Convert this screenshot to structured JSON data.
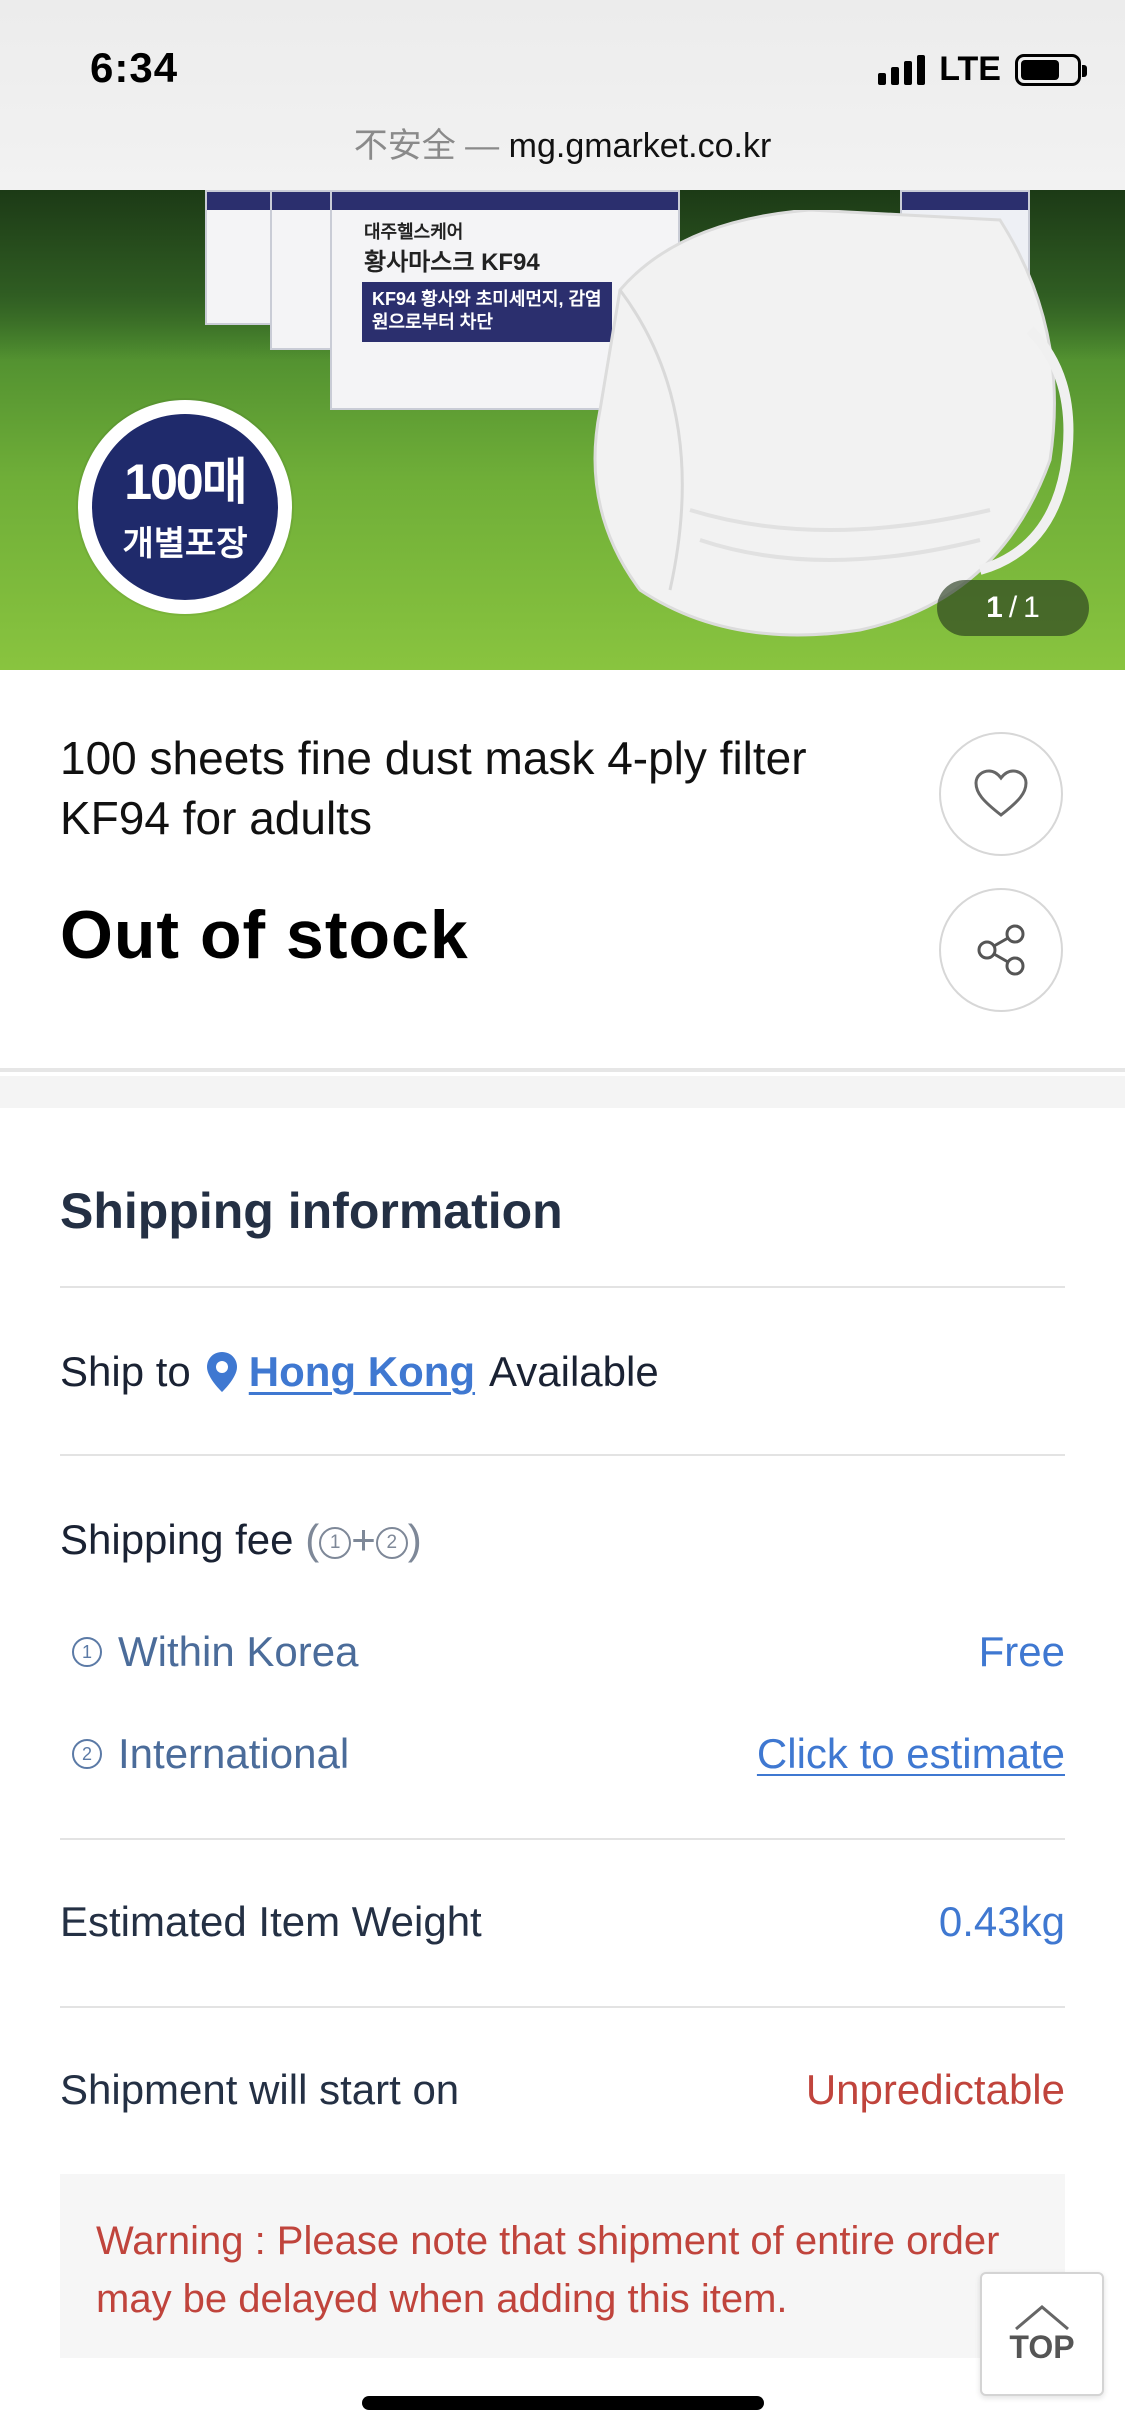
{
  "status_bar": {
    "time": "6:34",
    "network": "LTE"
  },
  "browser": {
    "insecure_label": "不安全",
    "separator": " — ",
    "host": "mg.gmarket.co.kr"
  },
  "product_image": {
    "badge_top": "100매",
    "badge_bottom": "개별포장",
    "box_brand": "대주헬스케어",
    "box_title": "황사마스크 KF94",
    "box_label": "KF94 황사와 초미세먼지, 감염원으로부터 차단",
    "counter_current": "1",
    "counter_separator": "/",
    "counter_total": "1"
  },
  "product": {
    "title": "100 sheets fine dust mask 4-ply filter KF94 for adults",
    "stock_status": "Out of stock"
  },
  "shipping": {
    "section_title": "Shipping information",
    "ship_to_label": "Ship to",
    "country": "Hong Kong",
    "available_label": "Available",
    "fee_label": "Shipping fee",
    "fee_note_open": "(",
    "fee_note_plus": "+",
    "fee_note_close": ")",
    "circle_1": "1",
    "circle_2": "2",
    "within_label": "Within Korea",
    "within_value": "Free",
    "international_label": "International",
    "international_link": "Click to estimate",
    "weight_label": "Estimated Item Weight",
    "weight_value": "0.43kg",
    "start_label": "Shipment will start on",
    "start_value": "Unpredictable",
    "warning": "Warning : Please note that shipment of entire order may be delayed when adding this item."
  },
  "top_button": {
    "label": "TOP"
  },
  "colors": {
    "link_blue": "#3f78d1",
    "warning_red": "#c0443c",
    "heading_navy": "#243044",
    "badge_navy": "#1f2a6b"
  },
  "icons": {
    "wishlist": "heart-icon",
    "share": "share-icon",
    "location": "map-pin-icon",
    "top": "chevron-up-icon"
  }
}
